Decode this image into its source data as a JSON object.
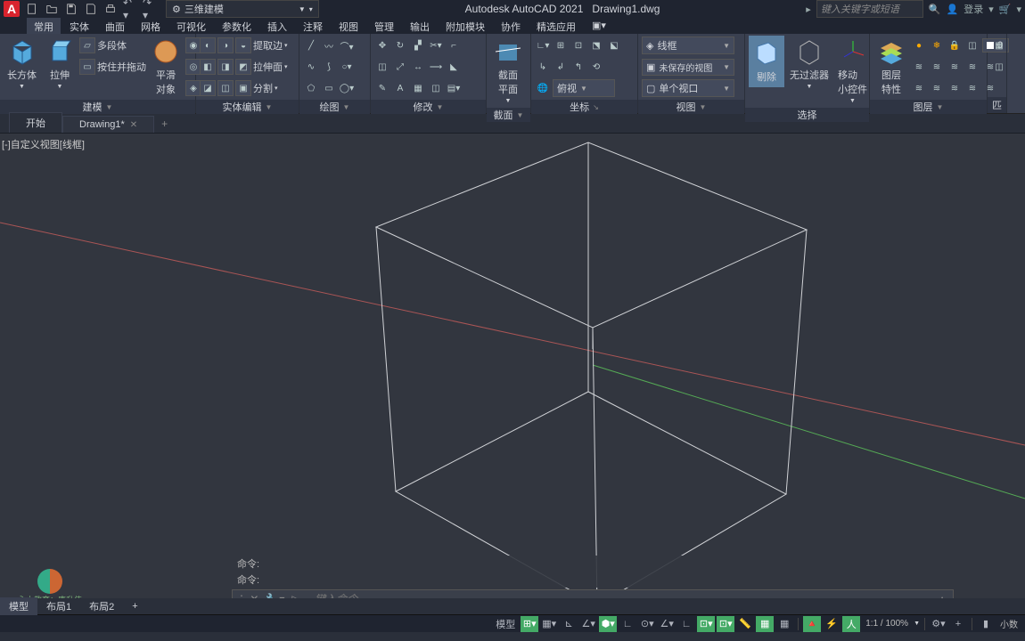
{
  "title": {
    "app": "Autodesk AutoCAD 2021",
    "file": "Drawing1.dwg"
  },
  "workspace": "三维建模",
  "search_placeholder": "键入关键字或短语",
  "login": "登录",
  "menu": [
    "常用",
    "实体",
    "曲面",
    "网格",
    "可视化",
    "参数化",
    "插入",
    "注释",
    "视图",
    "管理",
    "输出",
    "附加模块",
    "协作",
    "精选应用"
  ],
  "menu_active": 0,
  "panels": {
    "model": {
      "label": "建模",
      "big1": "长方体",
      "big2": "拉伸",
      "r1": "多段体",
      "r2": "按住并拖动",
      "r3": "平滑\n对象"
    },
    "solid": {
      "label": "实体编辑",
      "r1": "提取边",
      "r2": "拉伸面",
      "r3": "分割"
    },
    "draw": {
      "label": "绘图"
    },
    "modify": {
      "label": "修改"
    },
    "section": {
      "label": "截面",
      "big": "截面\n平面"
    },
    "coord": {
      "label": "坐标",
      "view": "俯视"
    },
    "view": {
      "label": "视图",
      "style": "线框",
      "saved": "未保存的视图",
      "single": "单个视口"
    },
    "select": {
      "label": "选择",
      "b1": "剔除",
      "b2": "无过滤器",
      "b3": "移动\n小控件"
    },
    "layer": {
      "label": "图层",
      "b1": "图层\n特性",
      "num": "0"
    },
    "misc": {
      "label": "匹"
    }
  },
  "filetabs": {
    "start": "开始",
    "active": "Drawing1*"
  },
  "canvas": {
    "viewlabel": "[-]自定义视图[线框]"
  },
  "watermark": "永木教育：唐升伟",
  "cmd": {
    "hist": "命令:",
    "placeholder": "键入命令"
  },
  "bottom_tabs": [
    "模型",
    "布局1",
    "布局2"
  ],
  "status": {
    "zoom": "1:1 / 100%",
    "dec": "小数"
  }
}
